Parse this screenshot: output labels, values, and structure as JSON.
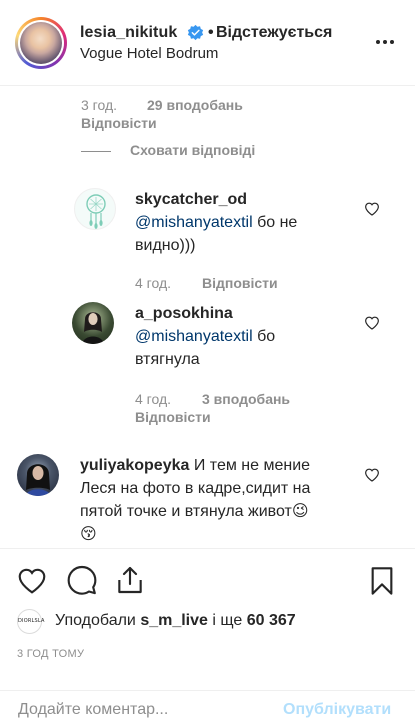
{
  "header": {
    "username": "lesia_nikituk",
    "separator": "•",
    "follow_label": "Відстежується",
    "location": "Vogue Hotel Bodrum",
    "verified_icon": "verified-badge-icon",
    "more_icon": "more-options-icon",
    "accent": "#3897f0"
  },
  "parent_meta": {
    "time": "3 год.",
    "likes": "29 вподобань",
    "reply": "Відповісти"
  },
  "hide_replies": "Сховати відповіді",
  "replies": [
    {
      "username": "skycatcher_od",
      "mention": "@mishanyatextil",
      "text_1": " бо не",
      "text_2": "видно)))",
      "time": "4 год.",
      "reply": "Відповісти"
    },
    {
      "username": "a_posokhina",
      "mention": "@mishanyatextil",
      "text_1": " бо",
      "text_2": "втягнула",
      "time": "4 год.",
      "likes": "3 вподобань",
      "reply": "Відповісти"
    }
  ],
  "comment": {
    "username": "yuliyakopeyka",
    "text_1": " И тем не мение",
    "text_2": "Леся на фото в кадре,сидит на",
    "text_3": "пятой точке и втянула живот",
    "emoji_1": "😉",
    "emoji_2": "😚"
  },
  "actions": {
    "like_icon": "heart-icon",
    "comment_icon": "comment-bubble-icon",
    "share_icon": "share-icon",
    "save_icon": "bookmark-icon"
  },
  "likes_row": {
    "avatar_text": "DIORLSLA",
    "prefix": "Уподобали ",
    "user": "s_m_live",
    "middle": " і ще ",
    "count": "60 367"
  },
  "timestamp": "3 ГОД ТОМУ",
  "comment_bar": {
    "placeholder": "Додайте коментар...",
    "publish": "Опублікувати",
    "publish_color": "#b2dffc"
  }
}
